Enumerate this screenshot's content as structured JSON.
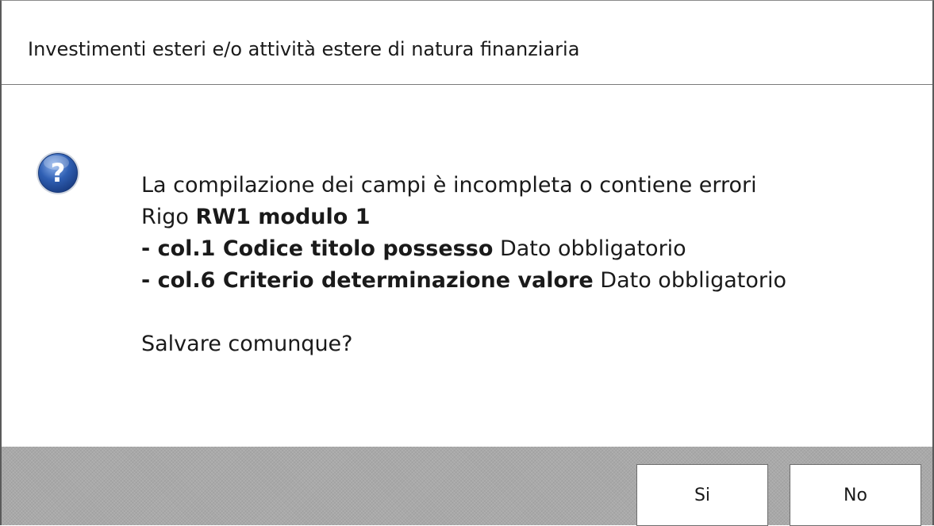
{
  "dialog": {
    "title": "Investimenti esteri e/o attività estere di natura finanziaria",
    "icon": "question-icon",
    "message": {
      "line1": "La compilazione dei campi è incompleta o contiene errori",
      "line2_prefix": "Rigo ",
      "line2_bold": "RW1 modulo 1",
      "line3_bold": "- col.1 Codice titolo possesso",
      "line3_rest": " Dato obbligatorio",
      "line4_bold": "- col.6 Criterio determinazione valore",
      "line4_rest": " Dato obbligatorio",
      "question": "Salvare comunque?"
    },
    "buttons": {
      "yes_label": "Si",
      "no_label": "No"
    },
    "colors": {
      "icon_blue": "#2f5fb3",
      "footer_gray": "#a9a9a9"
    }
  }
}
